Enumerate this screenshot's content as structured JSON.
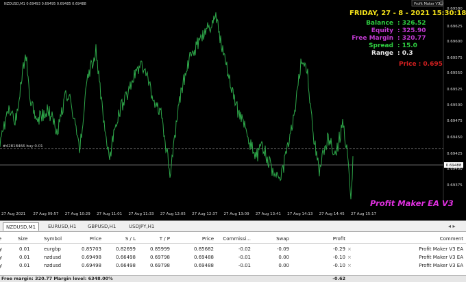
{
  "chart": {
    "symbol_info": "NZDUSD,M1  0.69493 0.69495 0.69485 0.69488",
    "ea_badge": "Profit Maker V3",
    "order_line_label": "#42818466 buy 0.01",
    "current_price_tag": "0.69488",
    "price_ticks": [
      "0.69580",
      "0.69625",
      "0.69600",
      "0.69575",
      "0.69550",
      "0.69525",
      "0.69500",
      "0.69475",
      "0.69450",
      "0.69425",
      "0.69400",
      "0.69375"
    ],
    "time_ticks": [
      "27 Aug 2021",
      "27 Aug 09:57",
      "27 Aug 10:29",
      "27 Aug 11:01",
      "27 Aug 11:33",
      "27 Aug 12:05",
      "27 Aug 12:37",
      "27 Aug 13:09",
      "27 Aug 13:41",
      "27 Aug 14:13",
      "27 Aug 14:45",
      "27 Aug 15:17"
    ],
    "colors": {
      "line": "#2ea84a",
      "order_line": "#9a9a9a",
      "bid_line": "#8a8a8a",
      "background": "#000000"
    }
  },
  "overlay": {
    "datetime": "FRIDAY, 27 - 8 - 2021 15:30:18",
    "balance_label": "Balance",
    "balance_value": ": 326.52",
    "equity_label": "Equity",
    "equity_value": ": 325.90",
    "free_margin_label": "Free Margin",
    "free_margin_value": ": 320.77",
    "spread_label": "Spread",
    "spread_value": ": 15.0",
    "range_label": "Range",
    "range_value": ": 0.3",
    "price_text": "Price : 0.695",
    "brand": "Profit Maker EA V3",
    "colors": {
      "datetime": "#f5e21a",
      "balance": "#2ecc40",
      "equity": "#c03ad0",
      "free_margin": "#c03ad0",
      "spread": "#2ecc40",
      "range": "#e8e8e8",
      "price": "#d42020",
      "brand": "#e030e0"
    }
  },
  "tabs": [
    {
      "label": "NZDUSD,M1",
      "active": true
    },
    {
      "label": "EURUSD,H1",
      "active": false
    },
    {
      "label": "GBPUSD,H1",
      "active": false
    },
    {
      "label": "USDJPY,H1",
      "active": false
    }
  ],
  "terminal": {
    "headers": {
      "type": "Type",
      "size": "Size",
      "symbol": "Symbol",
      "price": "Price",
      "sl": "S / L",
      "tp": "T / P",
      "price2": "Price",
      "commission": "Commissi...",
      "swap": "Swap",
      "profit": "Profit",
      "comment": "Comment"
    },
    "rows": [
      {
        "type": "buy",
        "size": "0.01",
        "symbol": "eurgbp",
        "price": "0.85703",
        "sl": "0.82699",
        "tp": "0.85999",
        "price2": "0.85682",
        "commission": "-0.02",
        "swap": "-0.09",
        "profit": "-0.29",
        "close": "×",
        "comment": "Profit Maker V3 EA"
      },
      {
        "type": "buy",
        "size": "0.01",
        "symbol": "nzdusd",
        "price": "0.69498",
        "sl": "0.66498",
        "tp": "0.69798",
        "price2": "0.69488",
        "commission": "-0.01",
        "swap": "0.00",
        "profit": "-0.10",
        "close": "×",
        "comment": "Profit Maker V3 EA"
      },
      {
        "type": "buy",
        "size": "0.01",
        "symbol": "nzdusd",
        "price": "0.69498",
        "sl": "0.66498",
        "tp": "0.69798",
        "price2": "0.69488",
        "commission": "-0.01",
        "swap": "0.00",
        "profit": "-0.10",
        "close": "×",
        "comment": "Profit Maker V3 EA"
      }
    ],
    "status_text": "Free margin: 320.77  Margin level: 6348.00%",
    "status_total": "-0.62"
  }
}
